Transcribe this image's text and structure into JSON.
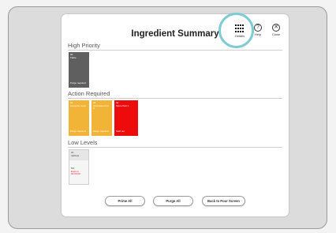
{
  "title": "Ingredient Summary",
  "toolbar": {
    "details_label": "Details",
    "help_label": "Help",
    "help_glyph": "?",
    "close_label": "Close",
    "close_glyph": "✕"
  },
  "sections": {
    "high_priority": {
      "label": "High Priority",
      "cards": [
        {
          "num": "06",
          "name": "Flatte",
          "status": "Purge required"
        }
      ]
    },
    "action_required": {
      "label": "Action Required",
      "cards": [
        {
          "num": "03",
          "name": "Ganache Coco",
          "status": "Purge required"
        },
        {
          "num": "04",
          "name": "Chocolate Pod A",
          "status": "Purge required"
        },
        {
          "num": "02",
          "name": "Spice Part 2",
          "status": "Sold out"
        }
      ]
    },
    "low_levels": {
      "label": "Low Levels",
      "cards": [
        {
          "num": "01",
          "name": "cashew",
          "level": "5%",
          "warning": "Ends in 00:00:00"
        }
      ]
    }
  },
  "buttons": {
    "prime_all": "Prime All",
    "purge_all": "Purge All",
    "back": "Back to Pour Screen"
  },
  "colors": {
    "dark": "#5f5f5f",
    "orange": "#f2b437",
    "red": "#ee0b0b",
    "highlight": "#7fcbd3"
  }
}
